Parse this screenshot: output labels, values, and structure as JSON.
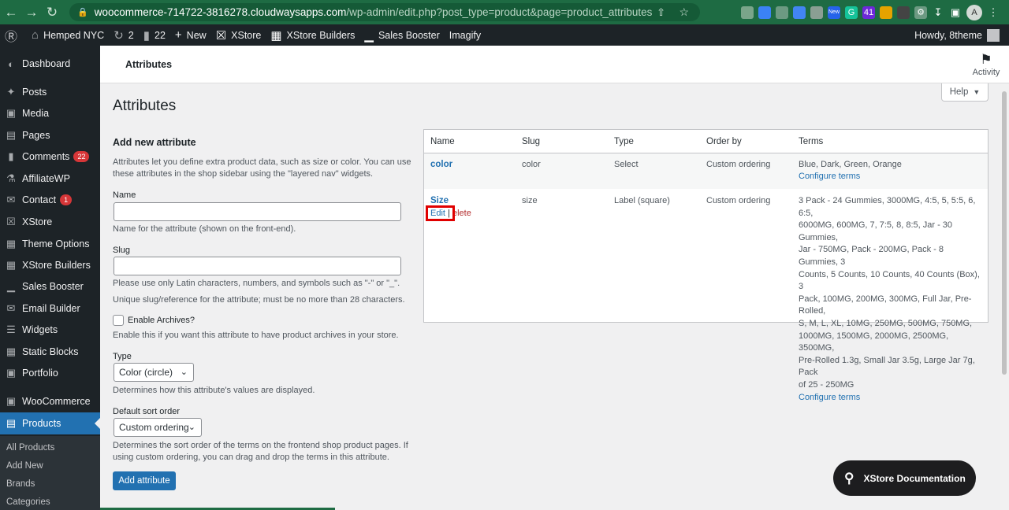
{
  "browser": {
    "url_host": "woocommerce-714722-3816278.cloudwaysapps.com",
    "url_path": "/wp-admin/edit.php?post_type=product&page=product_attributes",
    "extensions": [
      {
        "icon": "puzzle-ext-icon",
        "label": "",
        "color": "#7aa58a"
      },
      {
        "icon": "doc-ext-icon",
        "label": "",
        "color": "#3b82f6"
      },
      {
        "icon": "globe-ext-icon",
        "label": "",
        "color": "#6c9a82"
      },
      {
        "icon": "translate-ext-icon",
        "label": "",
        "color": "#4285f4"
      },
      {
        "icon": "camera-ext-icon",
        "label": "",
        "color": "#8a9f93"
      },
      {
        "icon": "new-ext-icon",
        "label": "New",
        "color": "#2563eb"
      },
      {
        "icon": "grammarly-ext-icon",
        "label": "G",
        "color": "#15c39a"
      },
      {
        "icon": "count-ext-icon",
        "label": "41",
        "color": "#6d28d9"
      },
      {
        "icon": "color-ext-icon",
        "label": "",
        "color": "#e6a300"
      },
      {
        "icon": "tag-ext-icon",
        "label": "",
        "color": "#444"
      }
    ],
    "profile_letter": "A"
  },
  "adminbar": {
    "site_name": "Hemped NYC",
    "updates_count": "2",
    "comments_count": "22",
    "new_label": "New",
    "xstore_label": "XStore",
    "xstore_builders_label": "XStore Builders",
    "sales_booster_label": "Sales Booster",
    "imagify_label": "Imagify",
    "howdy": "Howdy, 8theme"
  },
  "sidebar": {
    "dashboard": "Dashboard",
    "posts": "Posts",
    "media": "Media",
    "pages": "Pages",
    "comments": "Comments",
    "comments_badge": "22",
    "affiliatewp": "AffiliateWP",
    "contact": "Contact",
    "contact_badge": "1",
    "xstore": "XStore",
    "theme_options": "Theme Options",
    "xstore_builders": "XStore Builders",
    "sales_booster": "Sales Booster",
    "email_builder": "Email Builder",
    "widgets": "Widgets",
    "static_blocks": "Static Blocks",
    "portfolio": "Portfolio",
    "woocommerce": "WooCommerce",
    "products": "Products",
    "sub": {
      "all_products": "All Products",
      "add_new": "Add New",
      "brands": "Brands",
      "categories": "Categories"
    }
  },
  "topbar": {
    "title": "Attributes",
    "activity": "Activity"
  },
  "page": {
    "heading": "Attributes",
    "help_label": "Help"
  },
  "form": {
    "heading": "Add new attribute",
    "intro_line1": "Attributes let you define extra product data, such as size or color. You can use",
    "intro_line2": "these attributes in the shop sidebar using the \"layered nav\" widgets.",
    "name_label": "Name",
    "name_value": "",
    "name_help": "Name for the attribute (shown on the front-end).",
    "slug_label": "Slug",
    "slug_value": "",
    "slug_help1": "Please use only Latin characters, numbers, and symbols such as \"-\" or \"_\".",
    "slug_help2": "Unique slug/reference for the attribute; must be no more than 28 characters.",
    "archives_label": "Enable Archives?",
    "archives_help": "Enable this if you want this attribute to have product archives in your store.",
    "type_label": "Type",
    "type_value": "Color (circle)",
    "type_help": "Determines how this attribute's values are displayed.",
    "sort_label": "Default sort order",
    "sort_value": "Custom ordering",
    "sort_help1": "Determines the sort order of the terms on the frontend shop product pages. If",
    "sort_help2": "using custom ordering, you can drag and drop the terms in this attribute.",
    "submit_label": "Add attribute"
  },
  "table": {
    "headers": [
      "Name",
      "Slug",
      "Type",
      "Order by",
      "Terms"
    ],
    "rows": [
      {
        "name": "color",
        "slug": "color",
        "type": "Select",
        "order_by": "Custom ordering",
        "terms": "Blue, Dark, Green, Orange",
        "configure": "Configure terms"
      },
      {
        "name": "Size",
        "slug": "size",
        "type": "Label (square)",
        "order_by": "Custom ordering",
        "terms_lines": [
          "3 Pack - 24 Gummies, 3000MG, 4:5, 5, 5:5, 6, 6:5,",
          "6000MG, 600MG, 7, 7:5, 8, 8:5, Jar - 30 Gummies,",
          "Jar - 750MG, Pack - 200MG, Pack - 8 Gummies, 3",
          "Counts, 5 Counts, 10 Counts, 40 Counts (Box), 3",
          "Pack, 100MG, 200MG, 300MG, Full Jar, Pre-Rolled,",
          "S, M, L, XL, 10MG, 250MG, 500MG, 750MG,",
          "1000MG, 1500MG, 2000MG, 2500MG, 3500MG,",
          "Pre-Rolled 1.3g, Small Jar 3.5g, Large Jar 7g, Pack",
          "of 25 - 250MG"
        ],
        "configure": "Configure terms",
        "edit_label": "Edit",
        "separator": "|",
        "delete_label": "Delete",
        "delete_visible": "elete"
      }
    ]
  },
  "docs_button": "XStore Documentation",
  "colors": {
    "accent": "#2271b1",
    "sidebar_bg": "#1d2327",
    "highlight_box": "#e00000",
    "browser_bar": "#1e6b43"
  }
}
